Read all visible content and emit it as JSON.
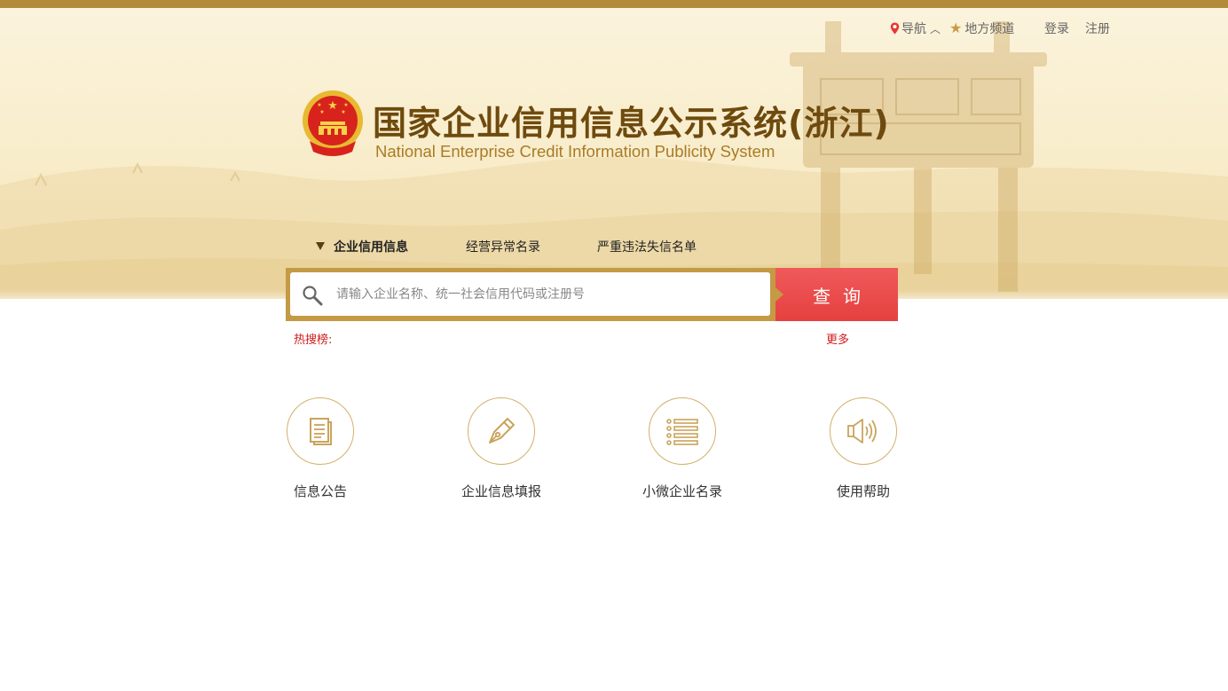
{
  "header": {
    "nav_direction": "导航",
    "nav_local_channels": "地方频道",
    "login": "登录",
    "register": "注册"
  },
  "brand": {
    "title": "国家企业信用信息公示系统(浙江)",
    "subtitle": "National Enterprise Credit Information Publicity System"
  },
  "tabs": [
    {
      "label": "企业信用信息",
      "active": true
    },
    {
      "label": "经营异常名录",
      "active": false
    },
    {
      "label": "严重违法失信名单",
      "active": false
    }
  ],
  "search": {
    "placeholder": "请输入企业名称、统一社会信用代码或注册号",
    "value": "",
    "button_label": "查询"
  },
  "hot_search": {
    "label": "热搜榜:",
    "more": "更多"
  },
  "features": [
    {
      "label": "信息公告",
      "icon": "document-icon"
    },
    {
      "label": "企业信息填报",
      "icon": "pen-nib-icon"
    },
    {
      "label": "小微企业名录",
      "icon": "list-icon"
    },
    {
      "label": "使用帮助",
      "icon": "speaker-icon"
    }
  ],
  "colors": {
    "accent_gold": "#c49a45",
    "brown_title": "#6e4a0e",
    "search_red": "#e64040",
    "hot_red": "#d21b1b"
  }
}
